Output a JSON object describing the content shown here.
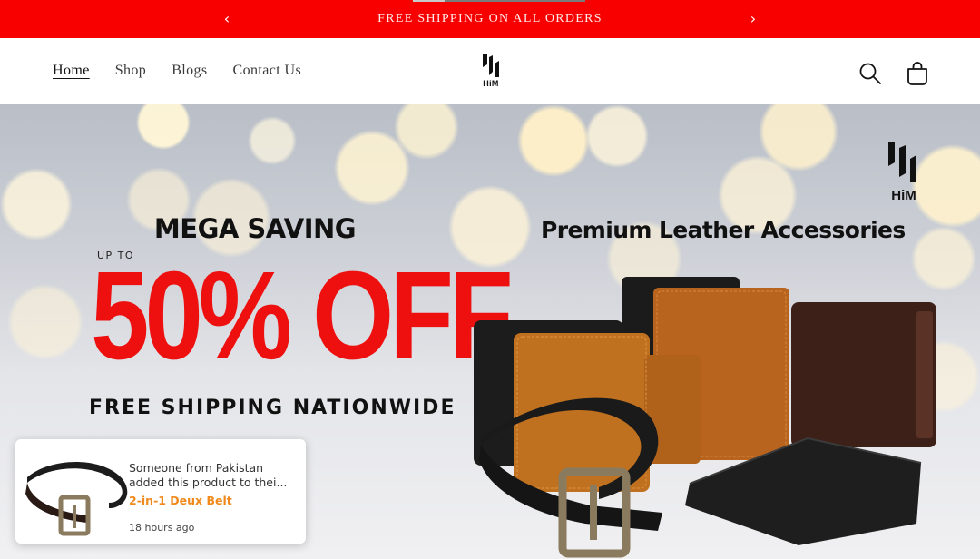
{
  "announcement": {
    "text": "FREE SHIPPING ON ALL ORDERS",
    "prev_icon": "chevron-left-icon",
    "next_icon": "chevron-right-icon"
  },
  "header": {
    "nav": [
      {
        "label": "Home",
        "active": true
      },
      {
        "label": "Shop",
        "active": false
      },
      {
        "label": "Blogs",
        "active": false
      },
      {
        "label": "Contact Us",
        "active": false
      }
    ],
    "logo_text": "HiM",
    "icons": [
      "search-icon",
      "cart-icon"
    ]
  },
  "hero": {
    "headline": "MEGA SAVING",
    "up_to": "UP TO",
    "discount": "50% OFF",
    "shipping": "FREE SHIPPING NATIONWIDE",
    "tagline": "Premium Leather Accessories",
    "logo_text": "HiM",
    "accent_color": "#ee0f0f"
  },
  "popup": {
    "line1": "Someone from Pakistan",
    "line2": "added this product to thei...",
    "product": "2-in-1 Deux Belt",
    "time": "18 hours ago",
    "product_color": "#f08a1c"
  },
  "colors": {
    "announcement_bg": "#f80000",
    "header_bg": "#ffffff"
  }
}
